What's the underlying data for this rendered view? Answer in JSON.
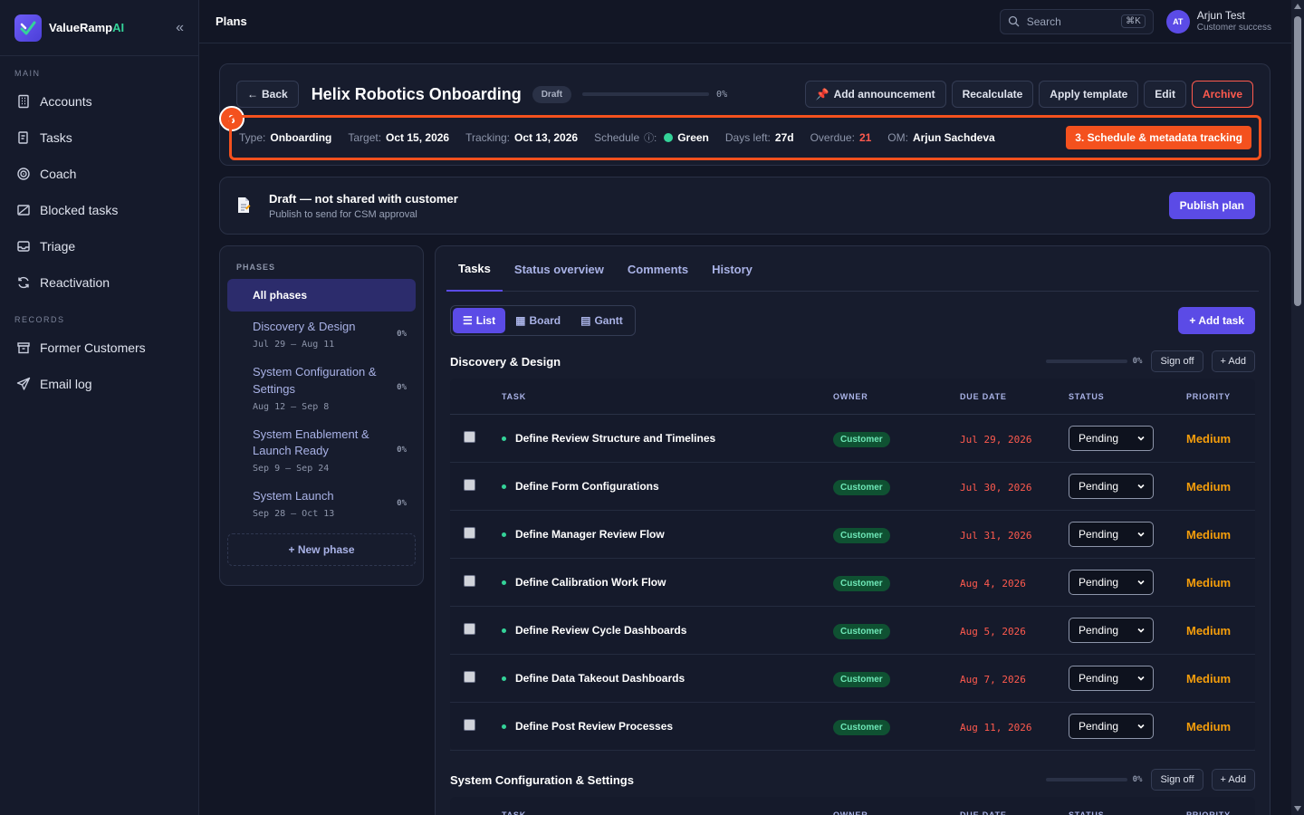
{
  "brand": {
    "name": "ValueRamp",
    "suffix": "AI"
  },
  "sidebar": {
    "main_label": "MAIN",
    "records_label": "RECORDS",
    "main_items": [
      "Accounts",
      "Tasks",
      "Coach",
      "Blocked tasks",
      "Triage",
      "Reactivation"
    ],
    "record_items": [
      "Former Customers",
      "Email log"
    ]
  },
  "topbar": {
    "title": "Plans",
    "search_placeholder": "Search",
    "search_shortcut": "⌘K",
    "user": {
      "initials": "AT",
      "name": "Arjun Test",
      "role": "Customer success"
    }
  },
  "plan": {
    "back": "Back",
    "title": "Helix Robotics Onboarding",
    "status": "Draft",
    "progress_pct": "0%",
    "progress_value": 0,
    "actions": {
      "announce": "Add announcement",
      "recalc": "Recalculate",
      "template": "Apply template",
      "edit": "Edit",
      "archive": "Archive"
    },
    "meta": {
      "type_label": "Type:",
      "type": "Onboarding",
      "target_label": "Target:",
      "target": "Oct 15, 2026",
      "tracking_label": "Tracking:",
      "tracking": "Oct 13, 2026",
      "schedule_label": "Schedule",
      "schedule": "Green",
      "days_left_label": "Days left:",
      "days_left": "27d",
      "overdue_label": "Overdue:",
      "overdue": "21",
      "om_label": "OM:",
      "om": "Arjun Sachdeva"
    },
    "step": {
      "number": "3",
      "label": "3. Schedule & metadata tracking"
    }
  },
  "draft_banner": {
    "title": "Draft — not shared with customer",
    "subtitle": "Publish to send for CSM approval",
    "publish": "Publish plan"
  },
  "phases": {
    "label": "PHASES",
    "all": "All phases",
    "items": [
      {
        "name": "Discovery & Design",
        "dates": "Jul 29 – Aug 11",
        "pct": "0%"
      },
      {
        "name": "System Configuration & Settings",
        "dates": "Aug 12 – Sep 8",
        "pct": "0%"
      },
      {
        "name": "System Enablement & Launch Ready",
        "dates": "Sep 9 – Sep 24",
        "pct": "0%"
      },
      {
        "name": "System Launch",
        "dates": "Sep 28 – Oct 13",
        "pct": "0%"
      }
    ],
    "new_phase": "+ New phase"
  },
  "tabs": [
    "Tasks",
    "Status overview",
    "Comments",
    "History"
  ],
  "views": [
    "List",
    "Board",
    "Gantt"
  ],
  "add_task": "+ Add task",
  "columns": {
    "task": "TASK",
    "owner": "OWNER",
    "due": "DUE DATE",
    "status": "STATUS",
    "priority": "PRIORITY"
  },
  "groups": [
    {
      "title": "Discovery & Design",
      "pct": "0%",
      "sign_off": "Sign off",
      "add": "+ Add",
      "rows": [
        {
          "task": "Define Review Structure and Timelines",
          "owner": "Customer",
          "due": "Jul 29, 2026",
          "status": "Pending",
          "priority": "Medium"
        },
        {
          "task": "Define Form Configurations",
          "owner": "Customer",
          "due": "Jul 30, 2026",
          "status": "Pending",
          "priority": "Medium"
        },
        {
          "task": "Define Manager Review Flow",
          "owner": "Customer",
          "due": "Jul 31, 2026",
          "status": "Pending",
          "priority": "Medium"
        },
        {
          "task": "Define Calibration Work Flow",
          "owner": "Customer",
          "due": "Aug 4, 2026",
          "status": "Pending",
          "priority": "Medium"
        },
        {
          "task": "Define Review Cycle Dashboards",
          "owner": "Customer",
          "due": "Aug 5, 2026",
          "status": "Pending",
          "priority": "Medium"
        },
        {
          "task": "Define Data Takeout Dashboards",
          "owner": "Customer",
          "due": "Aug 7, 2026",
          "status": "Pending",
          "priority": "Medium"
        },
        {
          "task": "Define Post Review Processes",
          "owner": "Customer",
          "due": "Aug 11, 2026",
          "status": "Pending",
          "priority": "Medium"
        }
      ]
    },
    {
      "title": "System Configuration & Settings",
      "pct": "0%",
      "sign_off": "Sign off",
      "add": "+ Add"
    }
  ],
  "colors": {
    "accent": "#5b4be6",
    "highlight": "#f4511e",
    "danger": "#ff5a4e",
    "success": "#34d399",
    "warning": "#f59e0b"
  }
}
